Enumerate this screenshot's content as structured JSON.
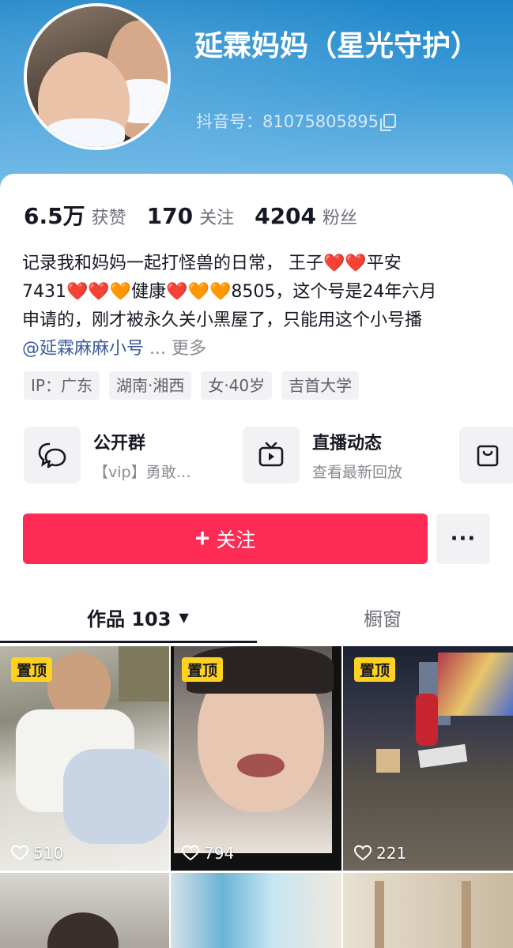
{
  "profile": {
    "nickname": "延霖妈妈（星光守护）",
    "douyin_id": "抖音号：81075805895",
    "stats": [
      {
        "num": "6.5万",
        "label": "获赞"
      },
      {
        "num": "170",
        "label": "关注"
      },
      {
        "num": "4204",
        "label": "粉丝"
      }
    ],
    "bio_lines": [
      "记录我和妈妈一起打怪兽的日常， 王子❤️❤️平安",
      "7431❤️❤️🧡健康❤️🧡🧡8505，这个号是24年六月",
      "申请的，刚才被永久关小黑屋了，只能用这个小号播"
    ],
    "bio_mention": "@延霖麻麻小号",
    "bio_ellipsis": "...",
    "bio_more": "更多",
    "tags": [
      "IP：广东",
      "湖南·湘西",
      "女·40岁",
      "吉首大学"
    ]
  },
  "entries": [
    {
      "title": "公开群",
      "subtitle": "【vip】勇敢…",
      "icon": "chat-bubbles-icon"
    },
    {
      "title": "直播动态",
      "subtitle": "查看最新回放",
      "icon": "tv-icon"
    },
    {
      "title": "",
      "subtitle": "",
      "icon": "shopping-bag-icon"
    }
  ],
  "actions": {
    "follow_label": "关注",
    "more_label": "···"
  },
  "tabs": {
    "works_label": "作品 103",
    "shop_label": "橱窗"
  },
  "videos": [
    {
      "pinned_label": "置顶",
      "likes": "510"
    },
    {
      "pinned_label": "置顶",
      "likes": "794"
    },
    {
      "pinned_label": "置顶",
      "likes": "221"
    }
  ],
  "colors": {
    "header": "#1f86c9",
    "follow_button": "#fe2c55",
    "pin_badge": "#ffd21f"
  }
}
